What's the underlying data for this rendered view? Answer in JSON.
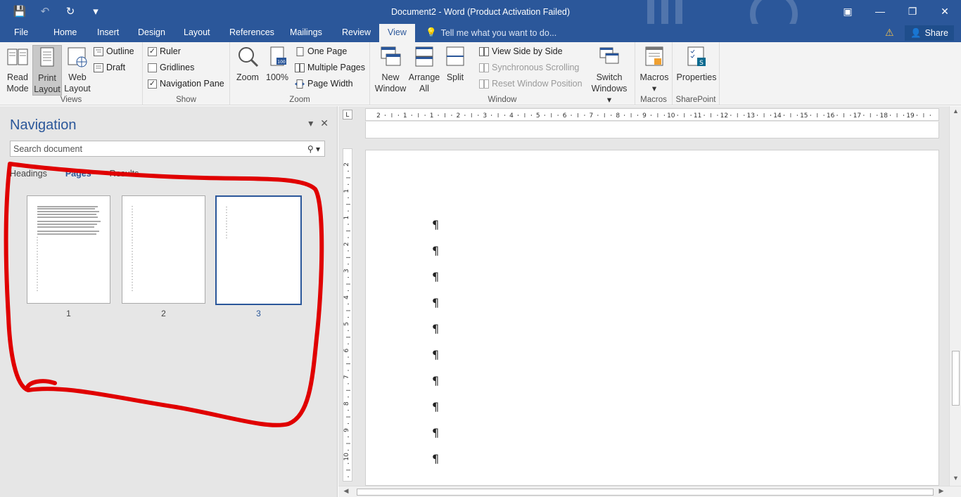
{
  "window": {
    "title": "Document2 - Word (Product Activation Failed)",
    "controls": {
      "ribbon_options": "▣",
      "minimize": "—",
      "restore": "❐",
      "close": "✕"
    }
  },
  "qat": {
    "save": "💾",
    "undo": "↶",
    "redo": "↻",
    "customize": "▾"
  },
  "tabs": {
    "file": "File",
    "home": "Home",
    "insert": "Insert",
    "design": "Design",
    "layout": "Layout",
    "references": "References",
    "mailings": "Mailings",
    "review": "Review",
    "view": "View",
    "tell_me": "Tell me what you want to do...",
    "share": "Share"
  },
  "ribbon": {
    "views": {
      "label": "Views",
      "read_mode": [
        "Read",
        "Mode"
      ],
      "print_layout": [
        "Print",
        "Layout"
      ],
      "web_layout": [
        "Web",
        "Layout"
      ],
      "outline": "Outline",
      "draft": "Draft"
    },
    "show": {
      "label": "Show",
      "ruler": {
        "label": "Ruler",
        "checked": "✓"
      },
      "gridlines": {
        "label": "Gridlines",
        "checked": ""
      },
      "navigation_pane": {
        "label": "Navigation Pane",
        "checked": "✓"
      }
    },
    "zoom": {
      "label": "Zoom",
      "zoom": "Zoom",
      "hundred": "100%",
      "one_page": "One Page",
      "multiple_pages": "Multiple Pages",
      "page_width": "Page Width"
    },
    "window": {
      "label": "Window",
      "new_window": [
        "New",
        "Window"
      ],
      "arrange_all": [
        "Arrange",
        "All"
      ],
      "split": "Split",
      "view_side_by_side": "View Side by Side",
      "sync_scrolling": "Synchronous Scrolling",
      "reset_window": "Reset Window Position",
      "switch_windows": [
        "Switch",
        "Windows ▾"
      ]
    },
    "macros": {
      "label": "Macros",
      "macros": "Macros",
      "arrow": "▾"
    },
    "sharepoint": {
      "label": "SharePoint",
      "properties": "Properties"
    }
  },
  "nav": {
    "title": "Navigation",
    "search_placeholder": "Search document",
    "tabs": {
      "headings": "Headings",
      "pages": "Pages",
      "results": "Results"
    },
    "pages": [
      {
        "number": "1",
        "selected": false
      },
      {
        "number": "2",
        "selected": false
      },
      {
        "number": "3",
        "selected": true
      }
    ]
  },
  "ruler": {
    "h_ticks": [
      "2",
      "1",
      "1",
      "2",
      "3",
      "4",
      "5",
      "6",
      "7",
      "8",
      "9",
      "10",
      "11",
      "12",
      "13",
      "14",
      "15",
      "16",
      "17",
      "18",
      "19"
    ],
    "v_ticks": [
      "2",
      "1",
      "1",
      "2",
      "3",
      "4",
      "5",
      "6",
      "7",
      "8",
      "9",
      "10"
    ]
  },
  "document": {
    "pilcrow": "¶",
    "paragraph_count": 10
  },
  "colors": {
    "accent": "#2b579a",
    "annotation": "#e00000"
  }
}
